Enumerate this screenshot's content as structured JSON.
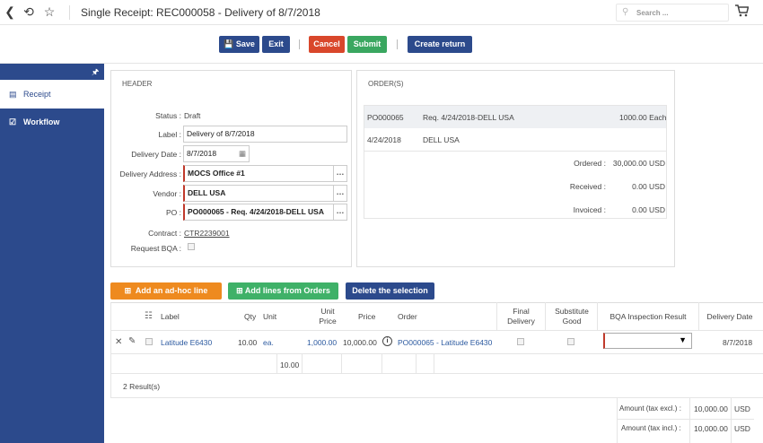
{
  "header": {
    "title": "Single Receipt: REC000058 - Delivery of 8/7/2018",
    "search_placeholder": "Search ..."
  },
  "toolbar": {
    "save": "Save",
    "exit": "Exit",
    "cancel": "Cancel",
    "submit": "Submit",
    "create_return": "Create return"
  },
  "sidebar": {
    "items": [
      {
        "label": "Receipt"
      },
      {
        "label": "Workflow"
      }
    ]
  },
  "header_panel": {
    "title": "HEADER",
    "status_label": "Status :",
    "status_value": "Draft",
    "label_label": "Label :",
    "label_value": "Delivery of 8/7/2018",
    "delivery_date_label": "Delivery Date :",
    "delivery_date_value": "8/7/2018",
    "delivery_address_label": "Delivery Address :",
    "delivery_address_value": "MOCS Office #1",
    "vendor_label": "Vendor :",
    "vendor_value": "DELL USA",
    "po_label": "PO :",
    "po_value": "PO000065 - Req. 4/24/2018-DELL USA",
    "contract_label": "Contract :",
    "contract_value": "CTR2239001",
    "request_bqa_label": "Request BQA :"
  },
  "orders_panel": {
    "title": "ORDER(S)",
    "row1_po": "PO000065",
    "row1_desc": "Req. 4/24/2018-DELL USA",
    "row1_qty": "1000.00 Each",
    "row2_date": "4/24/2018",
    "row2_vendor": "DELL USA",
    "ordered_label": "Ordered :",
    "ordered_value": "30,000.00 USD",
    "received_label": "Received :",
    "received_value": "0.00 USD",
    "invoiced_label": "Invoiced :",
    "invoiced_value": "0.00 USD"
  },
  "lines": {
    "add_adhoc": "Add an ad-hoc line",
    "add_from_orders": "Add lines from Orders",
    "delete_selection": "Delete the selection",
    "columns": {
      "label": "Label",
      "qty": "Qty",
      "unit": "Unit",
      "unit_price": "Unit Price",
      "price": "Price",
      "order": "Order",
      "final_delivery": "Final Delivery",
      "substitute_good": "Substitute Good",
      "bqa_result": "BQA Inspection Result",
      "delivery_date": "Delivery Date"
    },
    "row": {
      "label": "Latitude E6430",
      "qty": "10.00",
      "unit": "ea.",
      "unit_price": "1,000.00",
      "price": "10,000.00",
      "order": "PO000065 - Latitude E6430",
      "delivery_date": "8/7/2018"
    },
    "total_qty": "10.00",
    "results": "2 Result(s)",
    "amount_excl_label": "Amount (tax excl.) :",
    "amount_excl_value": "10,000.00",
    "amount_incl_label": "Amount (tax incl.) :",
    "amount_incl_value": "10,000.00",
    "currency": "USD"
  }
}
